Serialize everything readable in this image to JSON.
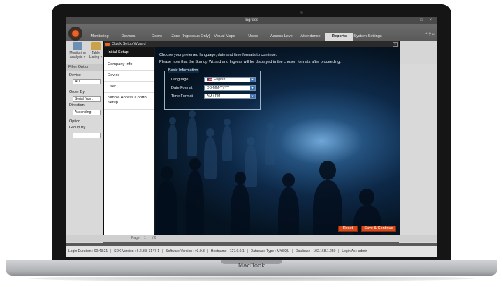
{
  "device": {
    "brand": "MacBook"
  },
  "window": {
    "title": "Ingress",
    "controls": "– □ ×"
  },
  "menu": {
    "tabs": [
      "Monitoring",
      "Devices",
      "Doors",
      "Zone (Ingressus Only)",
      "Visual Maps",
      "Users",
      "Access Level",
      "Attendance",
      "Reports",
      "System Settings"
    ],
    "active_tab": "Reports",
    "right": "^ ? ×"
  },
  "toolbar": {
    "buttons": [
      {
        "label": "Monitoring Analysis ▾",
        "icon": "chart-icon"
      },
      {
        "label": "Table Listing ▾",
        "icon": "table-icon"
      }
    ]
  },
  "filter": {
    "header": "Filter Option",
    "device_label": "Device",
    "device_value": "ALL",
    "order_by_label": "Order By",
    "order_by_value": "Serial Num.",
    "direction_label": "Direction",
    "direction_value": "Ascending",
    "option_label": "Option",
    "group_by_label": "Group By"
  },
  "pager": {
    "label": "Page",
    "value": "1",
    "of": "/ 0"
  },
  "dialog": {
    "title": "Quick Setup Wizard",
    "close": "×",
    "steps": [
      "Initial Setup",
      "Company Info",
      "Device",
      "User",
      "Simple Access Control Setup"
    ],
    "active_step": "Initial Setup",
    "intro_line1": "Choose your preferred language, date and time formats to continue.",
    "intro_line2": "Please note that the Startup Wizard and Ingress will be displayed in the chosen formats after proceeding.",
    "group_title": "Basic Information",
    "fields": [
      {
        "label": "Language",
        "value": "English"
      },
      {
        "label": "Date Format",
        "value": "DD-MM-YYYY"
      },
      {
        "label": "Time Format",
        "value": "AM / PM"
      }
    ],
    "reset_label": "Reset",
    "save_label": "Save & Continue"
  },
  "status": [
    "Login Duration : 00:43:21",
    "SDK Version : 6.2.3.8-3147-1",
    "Software Version : v3.0.3",
    "Hostname : 127.0.0.1",
    "Database Type : MYSQL",
    "Database : 192.168.1.250",
    "Login As : admin"
  ],
  "colors": {
    "accent": "#d4491a",
    "menu_bg": "#5e5e5e",
    "dialog_bg": "#1a1a1a",
    "select_arrow": "#3f73b8"
  }
}
